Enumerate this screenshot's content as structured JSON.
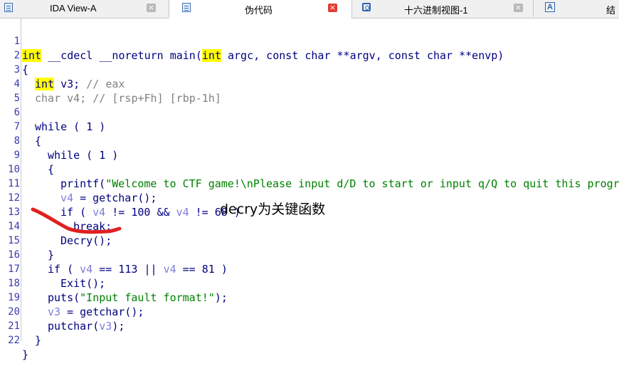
{
  "tabs": [
    {
      "label": "IDA View-A",
      "icon": "ida-view-icon"
    },
    {
      "label": "伪代码",
      "icon": "pseudocode-icon"
    },
    {
      "label": "十六进制视图-1",
      "icon": "hex-view-icon"
    },
    {
      "label": "结",
      "icon": "structures-icon"
    }
  ],
  "code": {
    "l1": {
      "n": "1",
      "int1": "int",
      "a": " __cdecl __noreturn main(",
      "int2": "int",
      "b": " argc, const char **argv, const char **envp)"
    },
    "l2": {
      "n": "2",
      "t": "{"
    },
    "l3": {
      "n": "3",
      "int": "int",
      "a": " v3; ",
      "c": "// eax"
    },
    "l4": {
      "n": "4",
      "t": "char v4; // [rsp+Fh] [rbp-1h]"
    },
    "l5": {
      "n": "5"
    },
    "l6": {
      "n": "6",
      "t": "while ( 1 )"
    },
    "l7": {
      "n": "7",
      "t": "{"
    },
    "l8": {
      "n": "8",
      "t": "while ( 1 )"
    },
    "l9": {
      "n": "9",
      "t": "{"
    },
    "l10": {
      "n": "10",
      "a": "printf(",
      "s": "\"Welcome to CTF game!\\nPlease input d/D to start or input q/Q to quit this progra"
    },
    "l11": {
      "n": "11",
      "v": "v4",
      "a": " = getchar();"
    },
    "l12": {
      "n": "12",
      "a": "if ( ",
      "v1": "v4",
      "b": " != 100 && ",
      "v2": "v4",
      "c": " != 68 )"
    },
    "l13": {
      "n": "13",
      "t": "break;"
    },
    "l14": {
      "n": "14",
      "t": "Decry();"
    },
    "l15": {
      "n": "15",
      "t": "}"
    },
    "l16": {
      "n": "16",
      "a": "if ( ",
      "v1": "v4",
      "b": " == 113 || ",
      "v2": "v4",
      "c": " == 81 )"
    },
    "l17": {
      "n": "17",
      "t": "Exit();"
    },
    "l18": {
      "n": "18",
      "a": "puts(",
      "s": "\"Input fault format!\"",
      "b": ");"
    },
    "l19": {
      "n": "19",
      "v": "v3",
      "a": " = getchar();"
    },
    "l20": {
      "n": "20",
      "a": "putchar(",
      "v": "v3",
      "b": ");"
    },
    "l21": {
      "n": "21",
      "t": "}"
    },
    "l22": {
      "n": "22",
      "t": "}"
    }
  },
  "annotation": "decry为关键函数",
  "colors": {
    "highlight": "#ffff00",
    "keyword": "#000080",
    "comment": "#808080",
    "variable": "#7d7dd8",
    "marker": "#e02020",
    "close_active": "#e03c31"
  }
}
